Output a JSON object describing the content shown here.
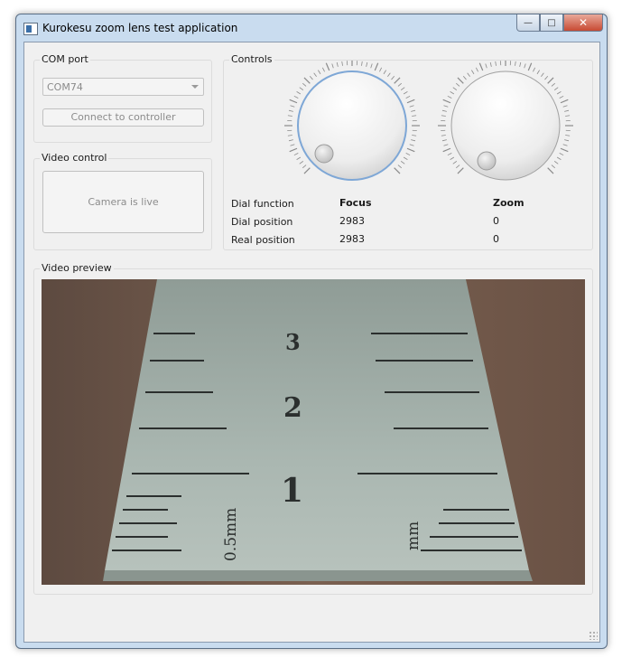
{
  "window": {
    "title": "Kurokesu zoom lens test application",
    "caption_buttons": [
      "minimize",
      "maximize",
      "close"
    ]
  },
  "com_port": {
    "group_title": "COM port",
    "selected_port": "COM74",
    "connect_button": "Connect to controller"
  },
  "video_control": {
    "group_title": "Video control",
    "status_button": "Camera is live"
  },
  "controls": {
    "group_title": "Controls",
    "row_labels": [
      "Dial function",
      "Dial position",
      "Real position"
    ],
    "focus": {
      "name": "Focus",
      "dial_position": "2983",
      "real_position": "2983"
    },
    "zoom": {
      "name": "Zoom",
      "dial_position": "0",
      "real_position": "0"
    }
  },
  "video_preview": {
    "group_title": "Video preview",
    "ruler_marks": [
      "1",
      "2",
      "3",
      "0.5mm",
      "mm"
    ]
  },
  "colors": {
    "window_frame": "#c9dcef",
    "client_bg": "#f0f0f0",
    "focus_ring": "#7ea7d6",
    "ruler_metal": "#a6b3ac",
    "wood": "#6b5448"
  }
}
